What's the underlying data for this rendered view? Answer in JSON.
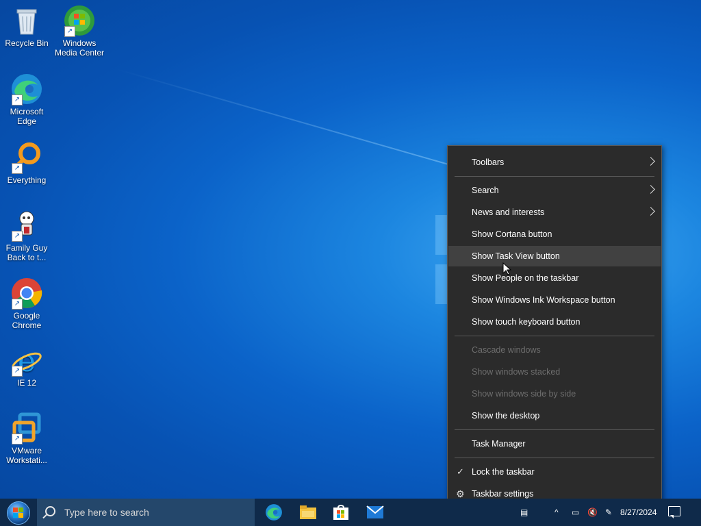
{
  "desktop": {
    "icons": [
      {
        "label": "Recycle Bin"
      },
      {
        "label": "Windows\nMedia Center"
      },
      {
        "label": "Microsoft\nEdge"
      },
      {
        "label": "Everything"
      },
      {
        "label": "Family Guy\nBack to t..."
      },
      {
        "label": "Google\nChrome"
      },
      {
        "label": "IE 12"
      },
      {
        "label": "VMware\nWorkstati..."
      }
    ]
  },
  "context_menu": {
    "items": [
      {
        "label": "Toolbars"
      },
      {
        "label": "Search"
      },
      {
        "label": "News and interests"
      },
      {
        "label": "Show Cortana button"
      },
      {
        "label": "Show Task View button"
      },
      {
        "label": "Show People on the taskbar"
      },
      {
        "label": "Show Windows Ink Workspace button"
      },
      {
        "label": "Show touch keyboard button"
      },
      {
        "label": "Cascade windows"
      },
      {
        "label": "Show windows stacked"
      },
      {
        "label": "Show windows side by side"
      },
      {
        "label": "Show the desktop"
      },
      {
        "label": "Task Manager"
      },
      {
        "label": "Lock the taskbar"
      },
      {
        "label": "Taskbar settings"
      }
    ]
  },
  "taskbar": {
    "search_placeholder": "Type here to search",
    "date": "8/27/2024"
  },
  "colors": {
    "menu_bg": "#2b2b2b",
    "menu_hover": "#414141",
    "taskbar_bg": "#0f2a4a",
    "disabled_text": "#6d6d6d"
  }
}
